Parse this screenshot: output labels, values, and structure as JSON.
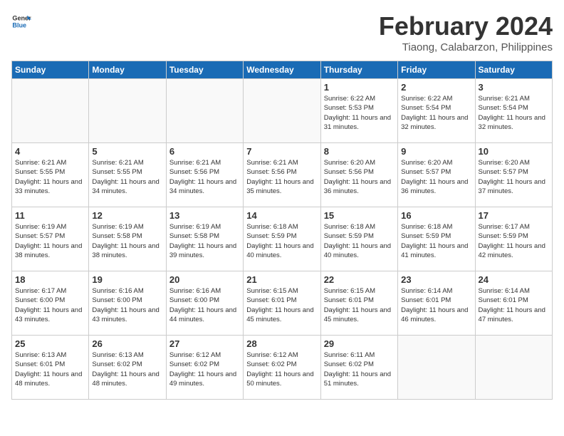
{
  "header": {
    "logo_general": "General",
    "logo_blue": "Blue",
    "title": "February 2024",
    "subtitle": "Tiaong, Calabarzon, Philippines"
  },
  "days_of_week": [
    "Sunday",
    "Monday",
    "Tuesday",
    "Wednesday",
    "Thursday",
    "Friday",
    "Saturday"
  ],
  "weeks": [
    [
      {
        "num": "",
        "sunrise": "",
        "sunset": "",
        "daylight": "",
        "empty": true
      },
      {
        "num": "",
        "sunrise": "",
        "sunset": "",
        "daylight": "",
        "empty": true
      },
      {
        "num": "",
        "sunrise": "",
        "sunset": "",
        "daylight": "",
        "empty": true
      },
      {
        "num": "",
        "sunrise": "",
        "sunset": "",
        "daylight": "",
        "empty": true
      },
      {
        "num": "1",
        "sunrise": "Sunrise: 6:22 AM",
        "sunset": "Sunset: 5:53 PM",
        "daylight": "Daylight: 11 hours and 31 minutes.",
        "empty": false
      },
      {
        "num": "2",
        "sunrise": "Sunrise: 6:22 AM",
        "sunset": "Sunset: 5:54 PM",
        "daylight": "Daylight: 11 hours and 32 minutes.",
        "empty": false
      },
      {
        "num": "3",
        "sunrise": "Sunrise: 6:21 AM",
        "sunset": "Sunset: 5:54 PM",
        "daylight": "Daylight: 11 hours and 32 minutes.",
        "empty": false
      }
    ],
    [
      {
        "num": "4",
        "sunrise": "Sunrise: 6:21 AM",
        "sunset": "Sunset: 5:55 PM",
        "daylight": "Daylight: 11 hours and 33 minutes.",
        "empty": false
      },
      {
        "num": "5",
        "sunrise": "Sunrise: 6:21 AM",
        "sunset": "Sunset: 5:55 PM",
        "daylight": "Daylight: 11 hours and 34 minutes.",
        "empty": false
      },
      {
        "num": "6",
        "sunrise": "Sunrise: 6:21 AM",
        "sunset": "Sunset: 5:56 PM",
        "daylight": "Daylight: 11 hours and 34 minutes.",
        "empty": false
      },
      {
        "num": "7",
        "sunrise": "Sunrise: 6:21 AM",
        "sunset": "Sunset: 5:56 PM",
        "daylight": "Daylight: 11 hours and 35 minutes.",
        "empty": false
      },
      {
        "num": "8",
        "sunrise": "Sunrise: 6:20 AM",
        "sunset": "Sunset: 5:56 PM",
        "daylight": "Daylight: 11 hours and 36 minutes.",
        "empty": false
      },
      {
        "num": "9",
        "sunrise": "Sunrise: 6:20 AM",
        "sunset": "Sunset: 5:57 PM",
        "daylight": "Daylight: 11 hours and 36 minutes.",
        "empty": false
      },
      {
        "num": "10",
        "sunrise": "Sunrise: 6:20 AM",
        "sunset": "Sunset: 5:57 PM",
        "daylight": "Daylight: 11 hours and 37 minutes.",
        "empty": false
      }
    ],
    [
      {
        "num": "11",
        "sunrise": "Sunrise: 6:19 AM",
        "sunset": "Sunset: 5:57 PM",
        "daylight": "Daylight: 11 hours and 38 minutes.",
        "empty": false
      },
      {
        "num": "12",
        "sunrise": "Sunrise: 6:19 AM",
        "sunset": "Sunset: 5:58 PM",
        "daylight": "Daylight: 11 hours and 38 minutes.",
        "empty": false
      },
      {
        "num": "13",
        "sunrise": "Sunrise: 6:19 AM",
        "sunset": "Sunset: 5:58 PM",
        "daylight": "Daylight: 11 hours and 39 minutes.",
        "empty": false
      },
      {
        "num": "14",
        "sunrise": "Sunrise: 6:18 AM",
        "sunset": "Sunset: 5:59 PM",
        "daylight": "Daylight: 11 hours and 40 minutes.",
        "empty": false
      },
      {
        "num": "15",
        "sunrise": "Sunrise: 6:18 AM",
        "sunset": "Sunset: 5:59 PM",
        "daylight": "Daylight: 11 hours and 40 minutes.",
        "empty": false
      },
      {
        "num": "16",
        "sunrise": "Sunrise: 6:18 AM",
        "sunset": "Sunset: 5:59 PM",
        "daylight": "Daylight: 11 hours and 41 minutes.",
        "empty": false
      },
      {
        "num": "17",
        "sunrise": "Sunrise: 6:17 AM",
        "sunset": "Sunset: 5:59 PM",
        "daylight": "Daylight: 11 hours and 42 minutes.",
        "empty": false
      }
    ],
    [
      {
        "num": "18",
        "sunrise": "Sunrise: 6:17 AM",
        "sunset": "Sunset: 6:00 PM",
        "daylight": "Daylight: 11 hours and 43 minutes.",
        "empty": false
      },
      {
        "num": "19",
        "sunrise": "Sunrise: 6:16 AM",
        "sunset": "Sunset: 6:00 PM",
        "daylight": "Daylight: 11 hours and 43 minutes.",
        "empty": false
      },
      {
        "num": "20",
        "sunrise": "Sunrise: 6:16 AM",
        "sunset": "Sunset: 6:00 PM",
        "daylight": "Daylight: 11 hours and 44 minutes.",
        "empty": false
      },
      {
        "num": "21",
        "sunrise": "Sunrise: 6:15 AM",
        "sunset": "Sunset: 6:01 PM",
        "daylight": "Daylight: 11 hours and 45 minutes.",
        "empty": false
      },
      {
        "num": "22",
        "sunrise": "Sunrise: 6:15 AM",
        "sunset": "Sunset: 6:01 PM",
        "daylight": "Daylight: 11 hours and 45 minutes.",
        "empty": false
      },
      {
        "num": "23",
        "sunrise": "Sunrise: 6:14 AM",
        "sunset": "Sunset: 6:01 PM",
        "daylight": "Daylight: 11 hours and 46 minutes.",
        "empty": false
      },
      {
        "num": "24",
        "sunrise": "Sunrise: 6:14 AM",
        "sunset": "Sunset: 6:01 PM",
        "daylight": "Daylight: 11 hours and 47 minutes.",
        "empty": false
      }
    ],
    [
      {
        "num": "25",
        "sunrise": "Sunrise: 6:13 AM",
        "sunset": "Sunset: 6:01 PM",
        "daylight": "Daylight: 11 hours and 48 minutes.",
        "empty": false
      },
      {
        "num": "26",
        "sunrise": "Sunrise: 6:13 AM",
        "sunset": "Sunset: 6:02 PM",
        "daylight": "Daylight: 11 hours and 48 minutes.",
        "empty": false
      },
      {
        "num": "27",
        "sunrise": "Sunrise: 6:12 AM",
        "sunset": "Sunset: 6:02 PM",
        "daylight": "Daylight: 11 hours and 49 minutes.",
        "empty": false
      },
      {
        "num": "28",
        "sunrise": "Sunrise: 6:12 AM",
        "sunset": "Sunset: 6:02 PM",
        "daylight": "Daylight: 11 hours and 50 minutes.",
        "empty": false
      },
      {
        "num": "29",
        "sunrise": "Sunrise: 6:11 AM",
        "sunset": "Sunset: 6:02 PM",
        "daylight": "Daylight: 11 hours and 51 minutes.",
        "empty": false
      },
      {
        "num": "",
        "sunrise": "",
        "sunset": "",
        "daylight": "",
        "empty": true
      },
      {
        "num": "",
        "sunrise": "",
        "sunset": "",
        "daylight": "",
        "empty": true
      }
    ]
  ]
}
